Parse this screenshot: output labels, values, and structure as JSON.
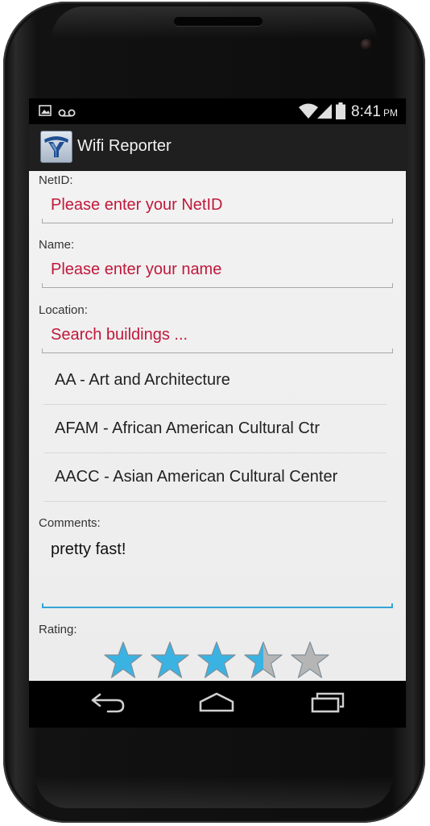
{
  "status_bar": {
    "time": "8:41",
    "ampm": "PM",
    "icons": [
      "image-icon",
      "voicemail-icon",
      "wifi-icon",
      "signal-icon",
      "battery-icon"
    ]
  },
  "action_bar": {
    "app_icon": "app-logo-icon",
    "title": "Wifi Reporter"
  },
  "form": {
    "netid_label": "NetID:",
    "netid_placeholder": "Please enter your NetID",
    "name_label": "Name:",
    "name_placeholder": "Please enter your name",
    "location_label": "Location:",
    "location_placeholder": "Search buildings ...",
    "location_suggestions": [
      "AA - Art and Architecture",
      "AFAM - African American Cultural Ctr",
      "AACC - Asian American Cultural Center"
    ],
    "comments_label": "Comments:",
    "comments_value": "pretty fast!",
    "rating_label": "Rating:",
    "rating_value": 3.5,
    "rating_max": 5
  },
  "nav_bar": {
    "icons": [
      "back-icon",
      "home-icon",
      "recent-apps-icon"
    ]
  },
  "colors": {
    "hint": "#c0183b",
    "focus_accent": "#33a3d6",
    "star_filled": "#3ab3e3",
    "star_empty": "#b5b5b5"
  }
}
